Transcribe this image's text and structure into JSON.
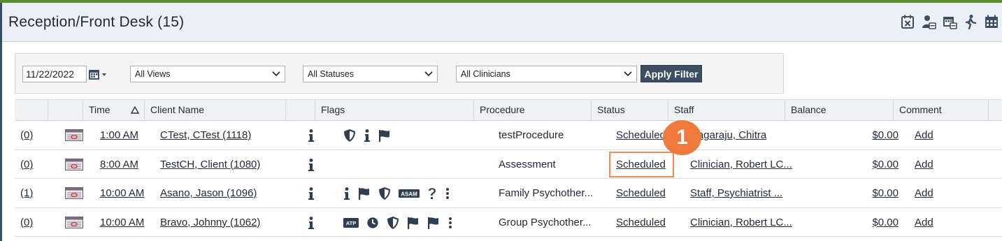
{
  "header": {
    "title": "Reception/Front Desk (15)",
    "toolbar_icons": [
      "calendar-x-icon",
      "staff-calendar-icon",
      "calendar-print-icon",
      "walk-in-icon",
      "calendar-grid-icon"
    ]
  },
  "filters": {
    "date": "11/22/2022",
    "views": "All Views",
    "statuses": "All Statuses",
    "clinicians": "All Clinicians",
    "apply_label": "Apply Filter"
  },
  "columns": {
    "time": "Time",
    "client": "Client Name",
    "flags": "Flags",
    "procedure": "Procedure",
    "status": "Status",
    "staff": "Staff",
    "balance": "Balance",
    "comment": "Comment"
  },
  "rows": [
    {
      "count": "(0)",
      "time": "1:00 AM",
      "client": "CTest, CTest (1118)",
      "procedure": "testProcedure",
      "status": "Scheduled",
      "staff": "Nagaraju, Chitra",
      "balance": "$0.00",
      "comment": "Add",
      "flags": [
        "shield-icon",
        "info-icon",
        "flag-icon"
      ]
    },
    {
      "count": "(0)",
      "time": "8:00 AM",
      "client": "TestCH, Client (1080)",
      "procedure": "Assessment",
      "status": "Scheduled",
      "staff": "Clinician, Robert LC...",
      "balance": "$0.00",
      "comment": "Add",
      "flags": []
    },
    {
      "count": "(1)",
      "time": "10:00 AM",
      "client": "Asano, Jason (1096)",
      "procedure": "Family Psychother...",
      "status": "Scheduled",
      "staff": "Staff, Psychiatrist ...",
      "balance": "$0.00",
      "comment": "Add",
      "flags": [
        "info-icon",
        "flag-icon",
        "shield-icon",
        "asam-icon",
        "question-icon",
        "more-icon"
      ]
    },
    {
      "count": "(0)",
      "time": "10:00 AM",
      "client": "Bravo, Johnny (1062)",
      "procedure": "Group Psychother...",
      "status": "Scheduled",
      "staff": "Clinician, Robert LC...",
      "balance": "$0.00",
      "comment": "Add",
      "flags": [
        "atp-icon",
        "clock-icon",
        "shield-icon",
        "flag-icon",
        "flag-icon",
        "more-icon"
      ]
    }
  ],
  "callout": {
    "number": "1"
  },
  "colors": {
    "accent": "#3b4e63",
    "callout": "#f0793c",
    "header_bg": "#eaf0f6",
    "top_strip": "#5c8d2c"
  }
}
